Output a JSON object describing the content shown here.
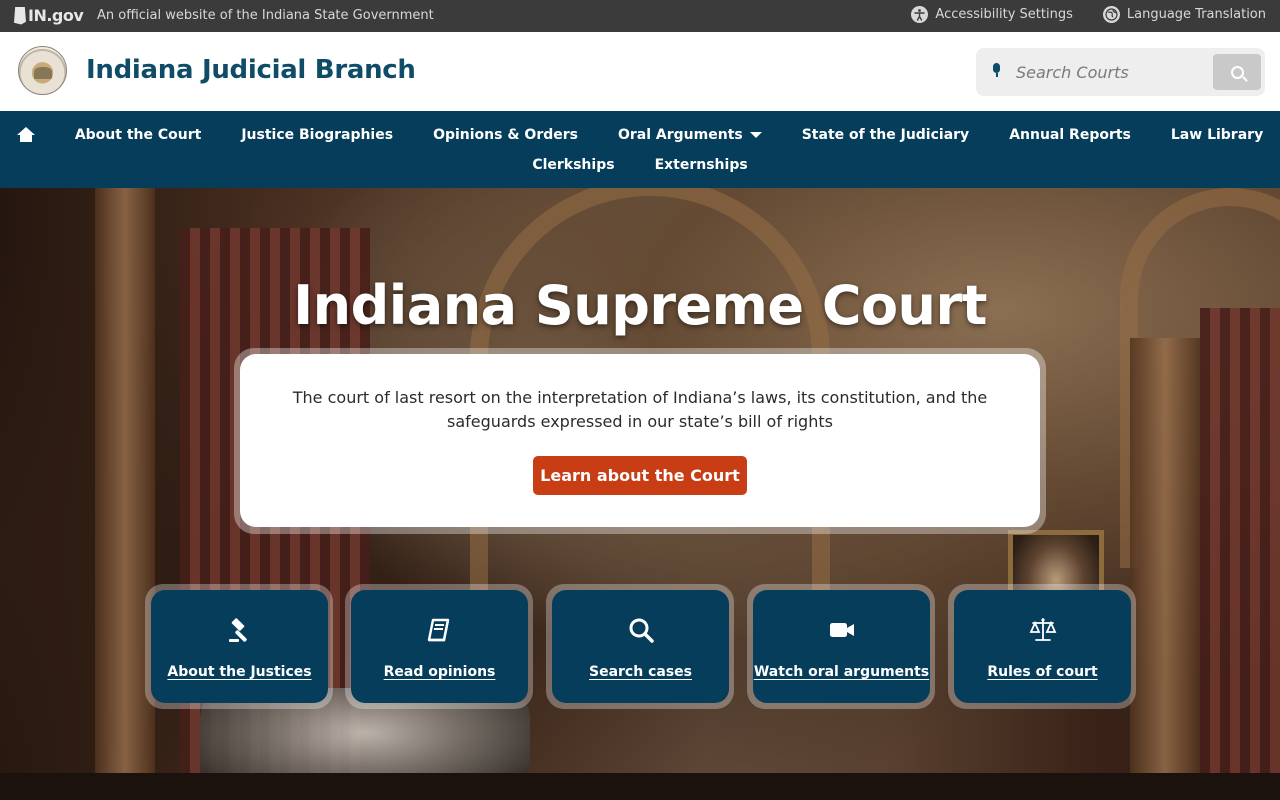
{
  "gov_bar": {
    "logo_text": "IN.gov",
    "official_text": "An official website of the Indiana State Government",
    "accessibility_label": "Accessibility Settings",
    "language_label": "Language Translation"
  },
  "header": {
    "site_title": "Indiana Judicial Branch",
    "search_placeholder": "Search Courts"
  },
  "nav": {
    "items": [
      {
        "label": "About the Court"
      },
      {
        "label": "Justice Biographies"
      },
      {
        "label": "Opinions & Orders"
      },
      {
        "label": "Oral Arguments"
      },
      {
        "label": "State of the Judiciary"
      },
      {
        "label": "Annual Reports"
      },
      {
        "label": "Law Library"
      },
      {
        "label": "Clerkships"
      },
      {
        "label": "Externships"
      }
    ]
  },
  "hero": {
    "title": "Indiana Supreme Court",
    "description": "The court of last resort on the interpretation of Indiana’s laws, its constitution, and the safeguards expressed in our state’s bill of rights",
    "button_label": "Learn about the Court"
  },
  "tiles": [
    {
      "label": "About the Justices",
      "icon": "gavel-icon"
    },
    {
      "label": "Read opinions",
      "icon": "book-icon"
    },
    {
      "label": "Search cases",
      "icon": "search-icon"
    },
    {
      "label": "Watch oral arguments",
      "icon": "video-camera-icon"
    },
    {
      "label": "Rules of court",
      "icon": "scales-icon"
    }
  ],
  "colors": {
    "gov_bar": "#3b3b3b",
    "brand_blue": "#063d5b",
    "title_blue": "#0f4c68",
    "cta_orange": "#c83d13"
  }
}
